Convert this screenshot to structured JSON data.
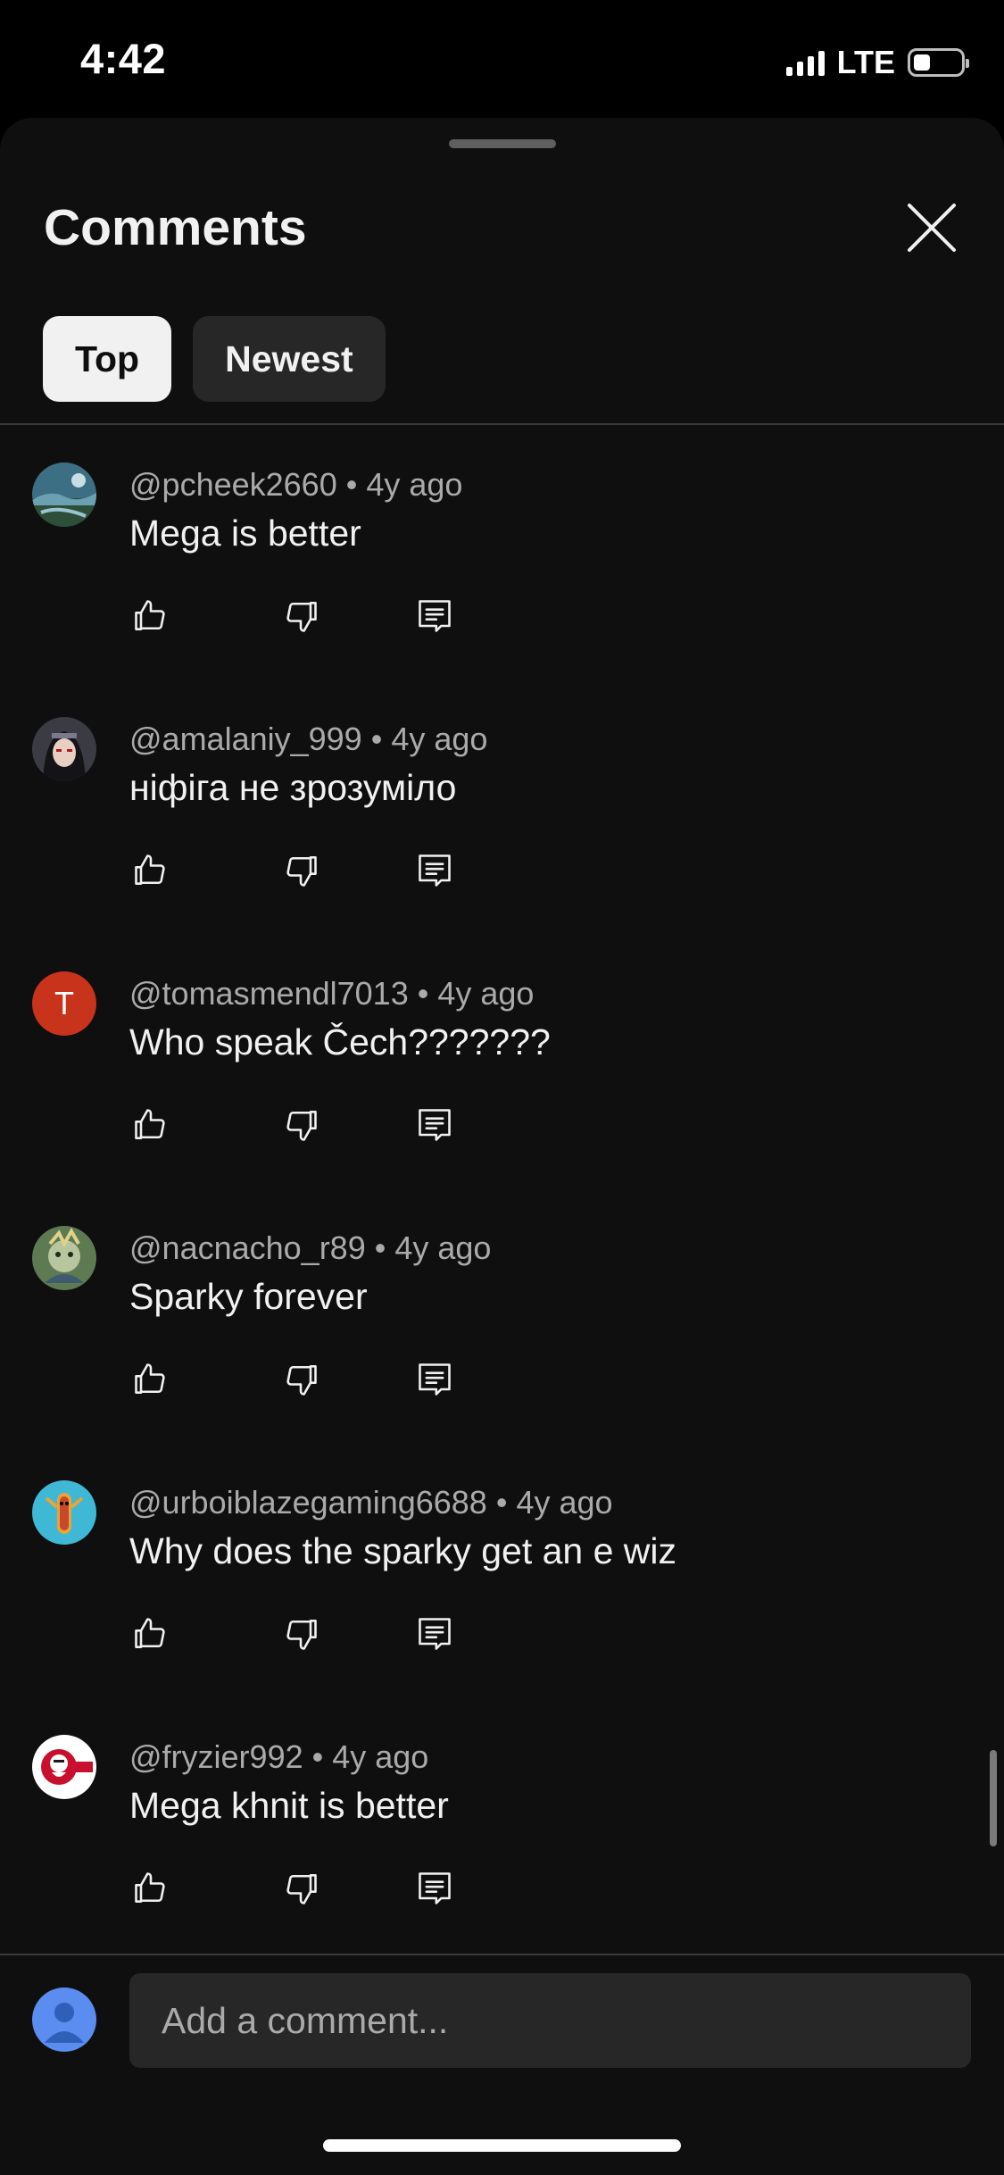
{
  "status_bar": {
    "time": "4:42",
    "network": "LTE",
    "battery_level": 0.35
  },
  "sheet": {
    "title": "Comments",
    "close_icon": "close-icon",
    "sort_tabs": [
      {
        "label": "Top",
        "active": true
      },
      {
        "label": "Newest",
        "active": false
      }
    ]
  },
  "comments": [
    {
      "author": "@pcheek2660",
      "age": "4y ago",
      "text": "Mega is better",
      "avatar": "landscape-photo"
    },
    {
      "author": "@amalaniy_999",
      "age": "4y ago",
      "text": "ніфіга не зрозуміло",
      "avatar": "anime-character"
    },
    {
      "author": "@tomasmendl7013",
      "age": "4y ago",
      "text": "Who speak Čech???????",
      "avatar_letter": "T",
      "avatar_color": "#c8331b"
    },
    {
      "author": "@nacnacho_r89",
      "age": "4y ago",
      "text": "Sparky forever",
      "avatar": "game-character"
    },
    {
      "author": "@urboiblazegaming6688",
      "age": "4y ago",
      "text": "Why does the sparky get an e wiz",
      "avatar": "hotdog-character",
      "avatar_color": "#3fb8d6"
    },
    {
      "author": "@fryzier992",
      "age": "4y ago",
      "text": "Mega khnit is better",
      "avatar": "kfc-logo"
    }
  ],
  "separator": "•",
  "composer": {
    "placeholder": "Add a comment..."
  },
  "colors": {
    "background": "#0f0f0f",
    "chip_active": "#f1f1f1",
    "chip_inactive": "#272727",
    "secondary_text": "#aaaaaa"
  }
}
